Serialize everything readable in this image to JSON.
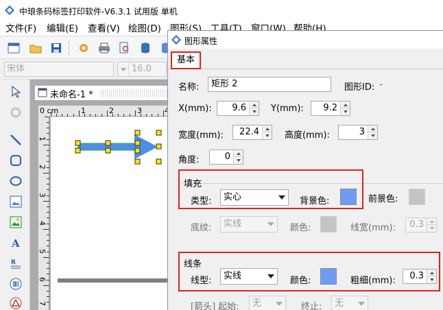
{
  "app": {
    "title": "中琅条码标签打印软件-V6.3.1 试用版 单机",
    "menu": [
      "文件(F)",
      "编辑(E)",
      "查看(V)",
      "绘图(D)",
      "图形(S)",
      "工具(T)",
      "窗口(W)",
      "帮助(H)"
    ],
    "toolbar_icons": [
      "new-icon",
      "open-icon",
      "save-icon",
      "settings-icon",
      "print-icon",
      "print-preview-icon",
      "database-icon",
      "database-setup-icon"
    ],
    "font_name": "宋体",
    "font_size": "16.0",
    "left_tools": [
      "pointer-icon",
      "rotate-icon",
      "line-icon",
      "rounded-rect-icon",
      "ellipse-icon",
      "image-icon",
      "picture-icon",
      "text-icon",
      "rich-text-icon",
      "barcode-icon",
      "qrcode-icon"
    ]
  },
  "document": {
    "tab_title": "未命名-1 *",
    "ruler_unit": "0 cm",
    "ruler_h": [
      "1",
      "2",
      "3",
      "4"
    ],
    "ruler_v": [
      "1",
      "2",
      "3",
      "4",
      "5",
      "6",
      "7"
    ]
  },
  "dialog": {
    "title": "图形属性",
    "tab": "基本",
    "name_label": "名称:",
    "name_value": "矩形 2",
    "id_label": "图形ID:",
    "id_value": "-",
    "x_label": "X(mm):",
    "x_value": "9.6",
    "y_label": "Y(mm):",
    "y_value": "9.2",
    "width_label": "宽度(mm):",
    "width_value": "22.4",
    "height_label": "高度(mm):",
    "height_value": "3",
    "angle_label": "角度:",
    "angle_value": "0",
    "fill": {
      "group_label": "填充",
      "type_label": "类型:",
      "type_value": "实心",
      "bg_label": "背景色:",
      "bg_color": "#6e9cf5",
      "fg_label": "前景色:",
      "fg_color": "#c4c4c4",
      "pattern_label": "底纹:",
      "pattern_value": "实线",
      "color_label": "颜色:",
      "color_value": "#c4c4c4",
      "linewidth_label": "线宽(mm):",
      "linewidth_value": "0.3"
    },
    "line": {
      "group_label": "线条",
      "type_label": "线型:",
      "type_value": "实线",
      "color_label": "颜色:",
      "color_value": "#6e9cf5",
      "width_label": "粗细(mm):",
      "width_value": "0.3"
    },
    "arrow": {
      "label": "[箭头] 起始:",
      "start_value": "无",
      "end_label": "终止:",
      "end_value": "无"
    }
  }
}
